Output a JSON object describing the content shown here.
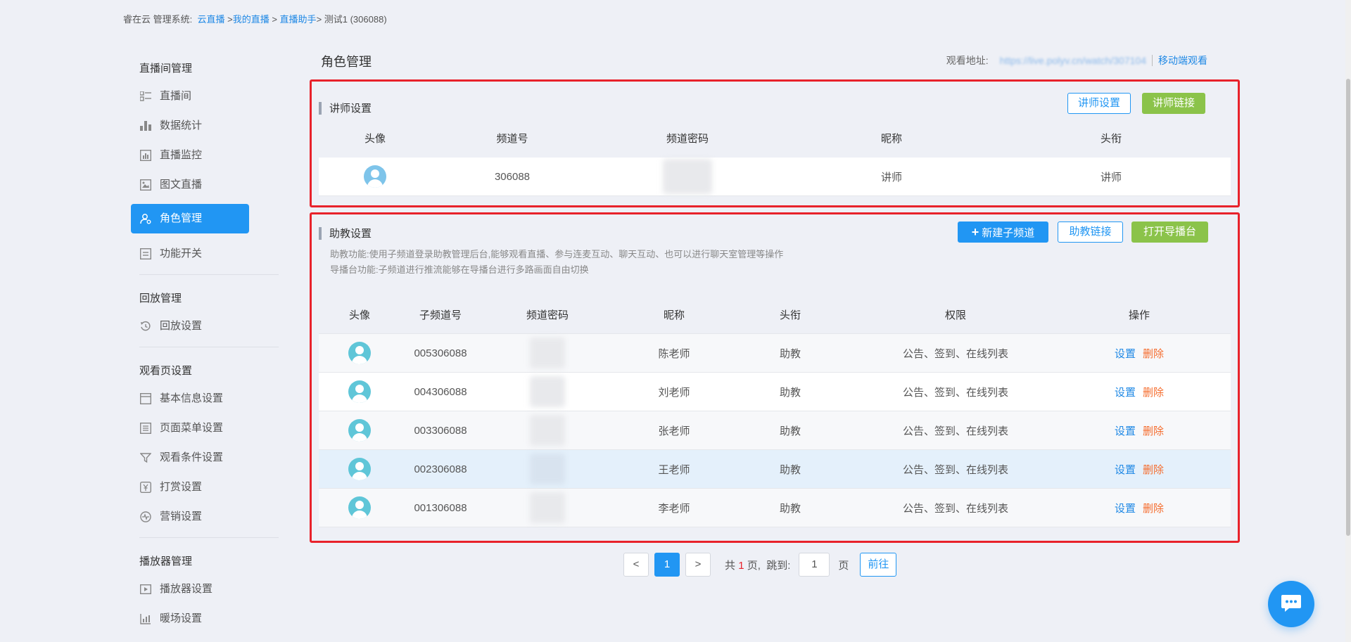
{
  "breadcrumb": {
    "prefix": "睿在云 管理系统:",
    "link1": "云直播",
    "sep1": " >",
    "link2": "我的直播",
    "sep2": " > ",
    "link3": "直播助手",
    "tail": "> 测试1 (306088)"
  },
  "sidebar": {
    "sections": [
      {
        "title": "直播间管理",
        "items": [
          "直播间",
          "数据统计",
          "直播监控",
          "图文直播",
          "角色管理",
          "功能开关"
        ]
      },
      {
        "title": "回放管理",
        "items": [
          "回放设置"
        ]
      },
      {
        "title": "观看页设置",
        "items": [
          "基本信息设置",
          "页面菜单设置",
          "观看条件设置",
          "打赏设置",
          "营销设置"
        ]
      },
      {
        "title": "播放器管理",
        "items": [
          "播放器设置",
          "暖场设置"
        ]
      }
    ],
    "active_item": "角色管理"
  },
  "page": {
    "title": "角色管理",
    "watch_label": "观看地址:",
    "watch_url": "https://live.polyv.cn/watch/307104",
    "mobile_watch": "移动端观看"
  },
  "lecturer": {
    "title": "讲师设置",
    "btn_settings": "讲师设置",
    "btn_link": "讲师链接",
    "columns": [
      "头像",
      "频道号",
      "频道密码",
      "昵称",
      "头衔"
    ],
    "row": {
      "channel": "306088",
      "nickname": "讲师",
      "rank": "讲师"
    }
  },
  "assistant": {
    "title": "助教设置",
    "btn_new": "新建子频道",
    "btn_link": "助教链接",
    "btn_director": "打开导播台",
    "note1": "助教功能:使用子频道登录助教管理后台,能够观看直播、参与连麦互动、聊天互动、也可以进行聊天室管理等操作",
    "note2": "导播台功能:子频道进行推流能够在导播台进行多路画面自由切换",
    "columns": [
      "头像",
      "子频道号",
      "频道密码",
      "昵称",
      "头衔",
      "权限",
      "操作"
    ],
    "rows": [
      {
        "channel": "005306088",
        "nickname": "陈老师",
        "rank": "助教",
        "perm": "公告、签到、在线列表",
        "op_set": "设置",
        "op_del": "删除"
      },
      {
        "channel": "004306088",
        "nickname": "刘老师",
        "rank": "助教",
        "perm": "公告、签到、在线列表",
        "op_set": "设置",
        "op_del": "删除"
      },
      {
        "channel": "003306088",
        "nickname": "张老师",
        "rank": "助教",
        "perm": "公告、签到、在线列表",
        "op_set": "设置",
        "op_del": "删除"
      },
      {
        "channel": "002306088",
        "nickname": "王老师",
        "rank": "助教",
        "perm": "公告、签到、在线列表",
        "op_set": "设置",
        "op_del": "删除"
      },
      {
        "channel": "001306088",
        "nickname": "李老师",
        "rank": "助教",
        "perm": "公告、签到、在线列表",
        "op_set": "设置",
        "op_del": "删除"
      }
    ],
    "highlighted_row": 3
  },
  "pager": {
    "prev": "<",
    "current": "1",
    "next": ">",
    "total_prefix": "共",
    "total": "1",
    "total_suffix": "页,",
    "jump_label": "跳到:",
    "jump_value": "1",
    "page_unit": "页",
    "go": "前往"
  },
  "colors": {
    "accent": "#2196f3",
    "green": "#8bc34a",
    "highlight_border": "#e8222b",
    "delete": "#f56c2d"
  }
}
